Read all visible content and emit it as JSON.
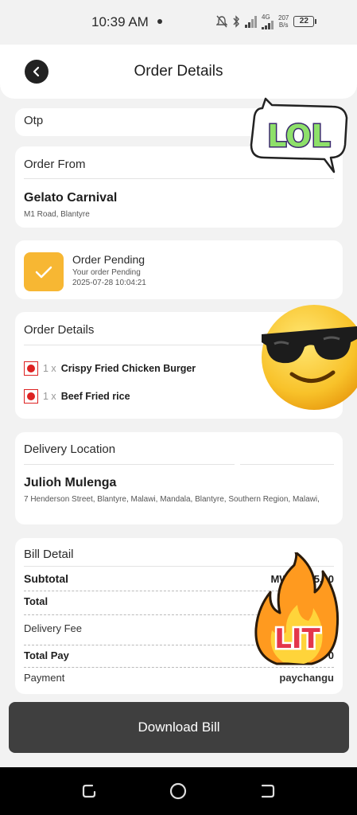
{
  "status_bar": {
    "time": "10:39 AM",
    "network_type": "4G",
    "net_speed_value": "207",
    "net_speed_unit": "B/s",
    "battery": "22"
  },
  "header": {
    "title": "Order Details"
  },
  "otp": {
    "label": "Otp"
  },
  "order_from": {
    "title": "Order From",
    "restaurant": "Gelato Carnival",
    "address": "M1 Road, Blantyre"
  },
  "order_status": {
    "title": "Order Pending",
    "message": "Your order Pending",
    "timestamp": "2025-07-28 10:04:21",
    "tile_color": "#f7b733"
  },
  "order_details": {
    "title": "Order Details",
    "items": [
      {
        "qty": "1 x",
        "name": "Crispy Fried Chicken Burger"
      },
      {
        "qty": "1 x",
        "name": "Beef Fried rice"
      }
    ]
  },
  "delivery": {
    "title": "Delivery Location",
    "name": "Julioh Mulenga",
    "address": "7 Henderson Street, Blantyre, Malawi, Mandala, Blantyre, Southern Region, Malawi,"
  },
  "bill": {
    "title": "Bill Detail",
    "rows": [
      {
        "label": "Subtotal",
        "value": "MWK27_5.00"
      },
      {
        "label": "Total",
        "value": "MW"
      },
      {
        "label": "Delivery Fee",
        "value": ""
      },
      {
        "label": "Total Pay",
        "value": "0"
      },
      {
        "label": "Payment",
        "value": "paychangu"
      }
    ]
  },
  "download_button": {
    "label": "Download Bill"
  },
  "stickers": {
    "lol": "LOL",
    "lit": "LIT"
  },
  "colors": {
    "accent": "#f7b733",
    "button_bg": "#3f3f3f",
    "veg_mark": "#dd2222"
  }
}
